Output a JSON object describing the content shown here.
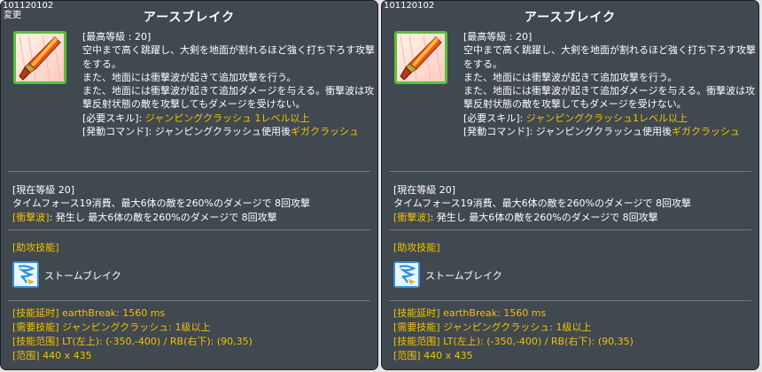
{
  "left": {
    "code": "101120102",
    "flag": "変更",
    "title": "アースブレイク",
    "icon": "earth-break-skill-icon",
    "desc": {
      "level_line": "[最高等級 : 20]",
      "text1": "空中まで高く跳躍し、大剣を地面が割れるほど強く打ち下ろす攻撃をする。",
      "text2": "また、地面には衝撃波が起きて追加攻撃を行う。",
      "text3": "また、地面には衝撃波が起きて追加ダメージを与える。衝撃波は攻撃反射状態の敵を攻撃してもダメージを受けない。",
      "req_label": "[必要スキル]: ",
      "req_value": "ジャンピングクラッシュ 1レベル以上",
      "cmd_label": "[発動コマンド]: ジャンピングクラッシュ使用後",
      "cmd_value": "ギガクラッシュ"
    },
    "current": {
      "level": "[現在等級 20]",
      "line1": "タイムフォース19消費、最大6体の敵を260%のダメージで 8回攻撃",
      "shock_label": "[衝撃波]",
      "shock_text": ": 発生し 最大6体の敵を260%のダメージで 8回攻撃"
    },
    "assist": {
      "header": "[助攻技能]",
      "icon": "storm-break-skill-icon",
      "name": "ストームブレイク"
    },
    "stats": [
      "[技能延时] earthBreak: 1560 ms",
      "[需要技能] ジャンピングクラッシュ: 1级以上",
      "[技能范围] LT(左上): (-350,-400) / RB(右下): (90,35)",
      "[范围] 440 x 435"
    ]
  },
  "right": {
    "code": "101120102",
    "title": "アースブレイク",
    "icon": "earth-break-skill-icon",
    "desc": {
      "level_line": "[最高等級 : 20]",
      "text1": "空中まで高く跳躍し、大剣を地面が割れるほど強く打ち下ろす攻撃をする。",
      "text2": "また、地面には衝撃波が起きて追加攻撃を行う。",
      "text3": "また、地面には衝撃波が起きて追加ダメージを与える。衝撃波は攻撃反射状態の敵を攻撃してもダメージを受けない。",
      "req_label": "[必要スキル]: ",
      "req_value": "ジャンピングクラッシュ1レベル以上",
      "cmd_label": "[発動コマンド]: ジャンピングクラッシュ使用後",
      "cmd_value": "ギガクラッシュ"
    },
    "current": {
      "level": "[現在等級 20]",
      "line1": "タイムフォース19消費、最大6体の敵を260%のダメージで 8回攻撃",
      "shock_label": "[衝撃波]",
      "shock_text": ": 発生し 最大6体の敵を260%のダメージで 8回攻撃"
    },
    "assist": {
      "header": "[助攻技能]",
      "icon": "storm-break-skill-icon",
      "name": "ストームブレイク"
    },
    "stats": [
      "[技能延时] earthBreak: 1560 ms",
      "[需要技能] ジャンピングクラッシュ: 1级以上",
      "[技能范围] LT(左上): (-350,-400) / RB(右下): (90,35)",
      "[范围] 440 x 435"
    ]
  }
}
